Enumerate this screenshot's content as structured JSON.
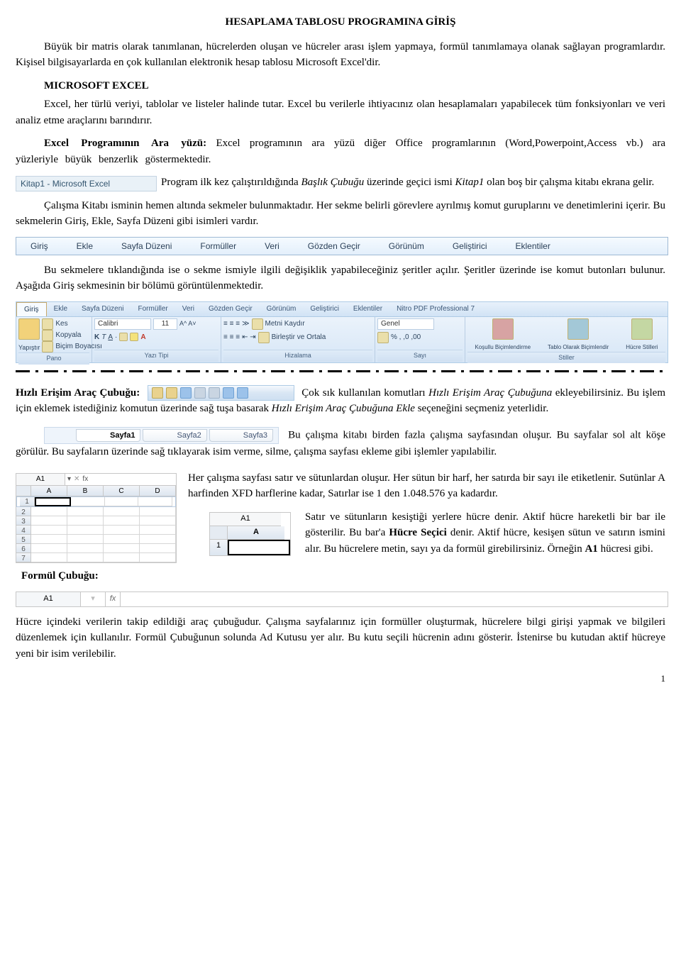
{
  "title": "HESAPLAMA TABLOSU PROGRAMINA GİRİŞ",
  "p1": "Büyük bir matris olarak tanımlanan, hücrelerden oluşan ve hücreler arası işlem yapmaya, formül tanımlamaya olanak sağlayan programlardır. Kişisel bilgisayarlarda en çok kullanılan elektronik hesap tablosu Microsoft Excel'dir.",
  "msExcelHead": "MICROSOFT EXCEL",
  "p2": "Excel, her türlü veriyi, tablolar ve listeler halinde tutar. Excel bu verilerle ihtiyacınız olan hesaplamaları yapabilecek tüm fonksiyonları ve veri analiz etme araçlarını barındırır.",
  "p3a": "Excel   Programının   Ara   yüzü:",
  "p3b": "   Excel   programının   ara   yüzü   diğer   Office   programlarının (Word,Powerpoint,Access vb.) ara yüzleriyle büyük benzerlik göstermektedir.",
  "titlebar": "Kitap1 - Microsoft Excel",
  "p4a": "Program ilk kez çalıştırıldığında ",
  "p4a_it1": "Başlık Çubuğu",
  "p4b": " üzerinde geçici ismi ",
  "p4b_it2": "Kitap1",
  "p4c": " olan boş bir çalışma kitabı ekrana gelir.",
  "p5": "Çalışma Kitabı isminin hemen altında sekmeler bulunmaktadır. Her sekme belirli görevlere ayrılmış komut guruplarını ve denetimlerini içerir. Bu sekmelerin Giriş, Ekle, Sayfa Düzeni gibi isimleri vardır.",
  "tabs": [
    "Giriş",
    "Ekle",
    "Sayfa Düzeni",
    "Formüller",
    "Veri",
    "Gözden Geçir",
    "Görünüm",
    "Geliştirici",
    "Eklentiler"
  ],
  "p6": "Bu sekmelere tıklandığında ise o sekme ismiyle ilgili değişiklik yapabileceğiniz şeritler açılır. Şeritler üzerinde ise komut butonları bulunur. Aşağıda Giriş sekmesinin bir bölümü görüntülenmektedir.",
  "ribbon": {
    "tabs": [
      "Giriş",
      "Ekle",
      "Sayfa Düzeni",
      "Formüller",
      "Veri",
      "Gözden Geçir",
      "Görünüm",
      "Geliştirici",
      "Eklentiler",
      "Nitro PDF Professional 7"
    ],
    "pano": {
      "label": "Pano",
      "paste": "Yapıştır",
      "cut": "Kes",
      "copy": "Kopyala",
      "brush": "Biçim Boyacısı"
    },
    "font": {
      "label": "Yazı Tipi",
      "name": "Calibri",
      "size": "11"
    },
    "align": {
      "label": "Hizalama",
      "wrap": "Metni Kaydır",
      "merge": "Birleştir ve Ortala"
    },
    "num": {
      "label": "Sayı",
      "fmt": "Genel"
    },
    "styles": {
      "label": "Stiller",
      "cond": "Koşullu Biçimlendirme",
      "tbl": "Tablo Olarak Biçimlendir",
      "cell": "Hücre Stilleri"
    }
  },
  "qat_label_b": "Hızlı Erişim Araç Çubuğu:",
  "p7a": "Çok sık kullanılan komutları ",
  "p7a_it": "Hızlı Erişim Araç Çubuğuna",
  "p7b": " ekleyebilirsiniz. Bu işlem için eklemek istediğiniz komutun üzerinde sağ tuşa basarak ",
  "p7b_it": "Hızlı Erişim Araç Çubuğuna Ekle",
  "p7c": " seçeneğini seçmeniz yeterlidir.",
  "sheets": {
    "s1": "Sayfa1",
    "s2": "Sayfa2",
    "s3": "Sayfa3"
  },
  "p8": "Bu çalışma kitabı birden fazla çalışma sayfasından oluşur. Bu sayfalar sol alt köşe görülür. Bu sayfaların üzerinde sağ tıklayarak isim verme, silme, çalışma sayfası ekleme gibi işlemler yapılabilir.",
  "mini": {
    "name": "A1",
    "cols": [
      "A",
      "B",
      "C",
      "D"
    ],
    "rows": [
      "1",
      "2",
      "3",
      "4",
      "5",
      "6",
      "7"
    ],
    "fx": "fx"
  },
  "p9": "Her çalışma sayfası satır ve sütunlardan oluşur. Her sütun bir harf, her satırda bir sayı ile etiketlenir. Sutünlar A harfinden XFD harflerine kadar, Satırlar ise 1 den 1.048.576 ya kadardır.",
  "miniA1": {
    "top": "A1",
    "col": "A",
    "row": "1"
  },
  "p10a": "Satır ve sütunların kesiştiği yerlere hücre denir. Aktif hücre hareketli bir bar ile gösterilir. Bu bar'a ",
  "p10b_bold": "Hücre Seçici",
  "p10c": " denir. Aktif hücre, kesişen sütun ve satırın ismini alır. Bu hücrelere metin, sayı ya da formül girebilirsiniz. Örneğin ",
  "p10d_bold": "A1",
  "p10e": " hücresi gibi.",
  "fbar_label": "Formül Çubuğu:",
  "fbar_name": "A1",
  "fbar_fx": "fx",
  "p11": "Hücre içindeki verilerin takip edildiği araç çubuğudur. Çalışma sayfalarınız için formüller oluşturmak, hücrelere bilgi girişi yapmak ve bilgileri düzenlemek için kullanılır. Formül Çubuğunun solunda Ad Kutusu yer alır. Bu kutu seçili hücrenin adını gösterir. İstenirse bu kutudan aktif hücreye yeni bir isim verilebilir.",
  "pagenum": "1"
}
